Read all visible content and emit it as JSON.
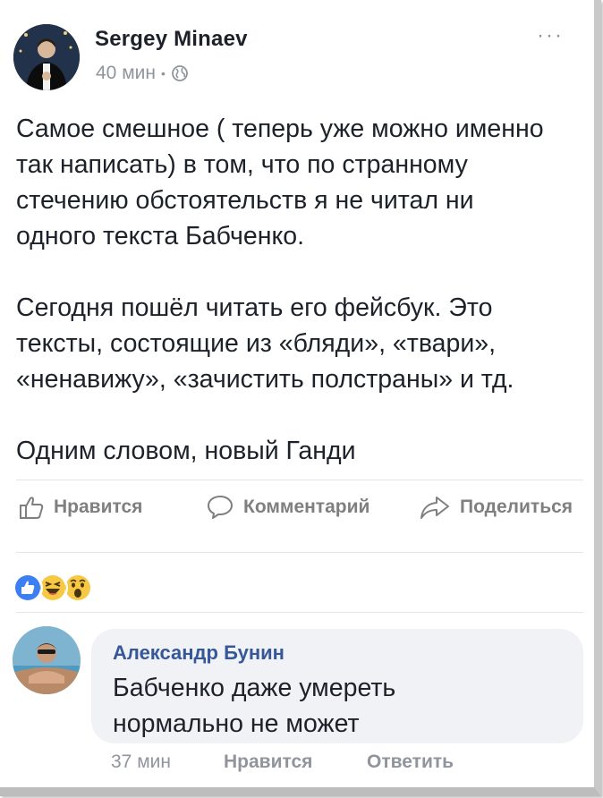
{
  "post": {
    "author": "Sergey Minaev",
    "time": "40 мин",
    "separator": "•",
    "more_label": "···",
    "privacy_icon": "globe-icon",
    "paragraphs": [
      "Самое смешное ( теперь уже можно именно\nтак написать) в том, что по странному\nстечению обстоятельств я не читал ни\nодного текста Бабченко.",
      "Сегодня пошёл читать его фейсбук. Это\nтексты, состоящие из «бляди», «твари»,\n«ненавижу», «зачистить полстраны» и тд.",
      "Одним словом, новый Ганди"
    ]
  },
  "actions": {
    "like": "Нравится",
    "comment": "Комментарий",
    "share": "Поделиться"
  },
  "reactions": [
    "like",
    "haha",
    "wow"
  ],
  "comment": {
    "author": "Александр Бунин",
    "text": "Бабченко даже умереть\nнормально не может",
    "time": "37 мин",
    "like": "Нравится",
    "reply": "Ответить"
  },
  "colors": {
    "text": "#1d2129",
    "meta": "#90949c",
    "action": "#7f7f7f",
    "link": "#365899",
    "bubble": "#f1f2f6",
    "like_blue": "#3b7ff2",
    "emoji_yellow": "#f7c844"
  }
}
